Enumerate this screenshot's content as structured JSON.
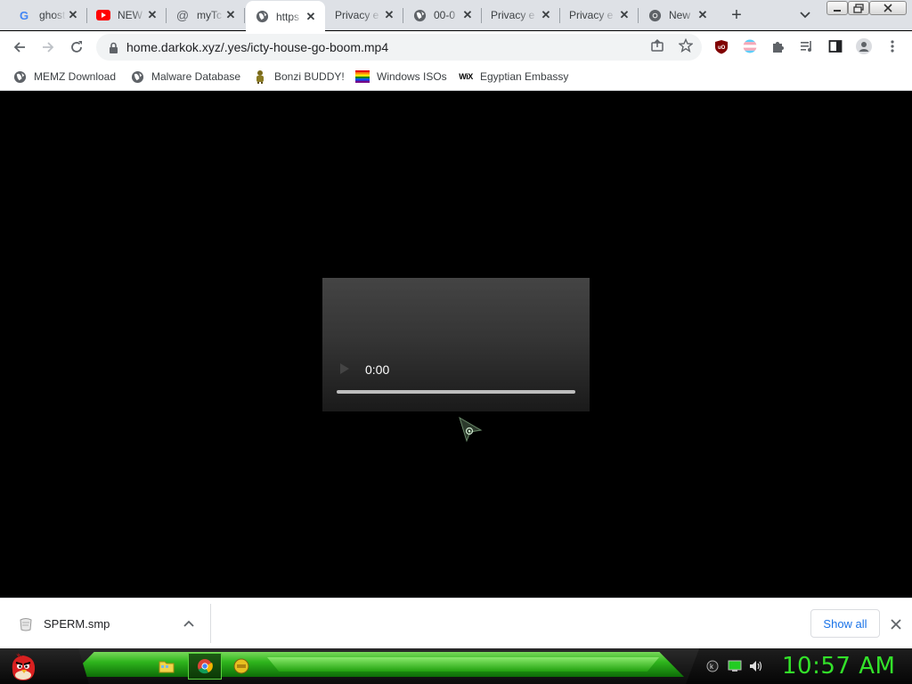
{
  "tabs": [
    {
      "title": "ghost",
      "icon": "google-icon"
    },
    {
      "title": "NEW",
      "icon": "youtube-icon"
    },
    {
      "title": "myTc",
      "icon": "at-sign-icon"
    },
    {
      "title": "https",
      "icon": "globe-icon",
      "active": true
    },
    {
      "title": "Privacy e",
      "icon": "none"
    },
    {
      "title": "00-0",
      "icon": "globe-icon"
    },
    {
      "title": "Privacy e",
      "icon": "none"
    },
    {
      "title": "Privacy e",
      "icon": "none"
    },
    {
      "title": "New",
      "icon": "chrome-icon"
    }
  ],
  "address_bar": {
    "url": "home.darkok.xyz/.yes/icty-house-go-boom.mp4"
  },
  "bookmarks": [
    {
      "label": "MEMZ Download",
      "icon": "globe-icon"
    },
    {
      "label": "Malware Database",
      "icon": "globe-icon"
    },
    {
      "label": "Bonzi BUDDY!",
      "icon": "bonzi-icon"
    },
    {
      "label": "Windows ISOs",
      "icon": "rainbow-flag-icon"
    },
    {
      "label": "Egyptian Embassy",
      "icon": "wix-icon"
    }
  ],
  "player": {
    "time": "0:00",
    "progress": 0
  },
  "download": {
    "filename": "SPERM.smp",
    "show_all_label": "Show all"
  },
  "taskbar": {
    "clock": "10:57 AM"
  },
  "colors": {
    "accent_green": "#33e22a",
    "link_blue": "#1a73e8"
  }
}
